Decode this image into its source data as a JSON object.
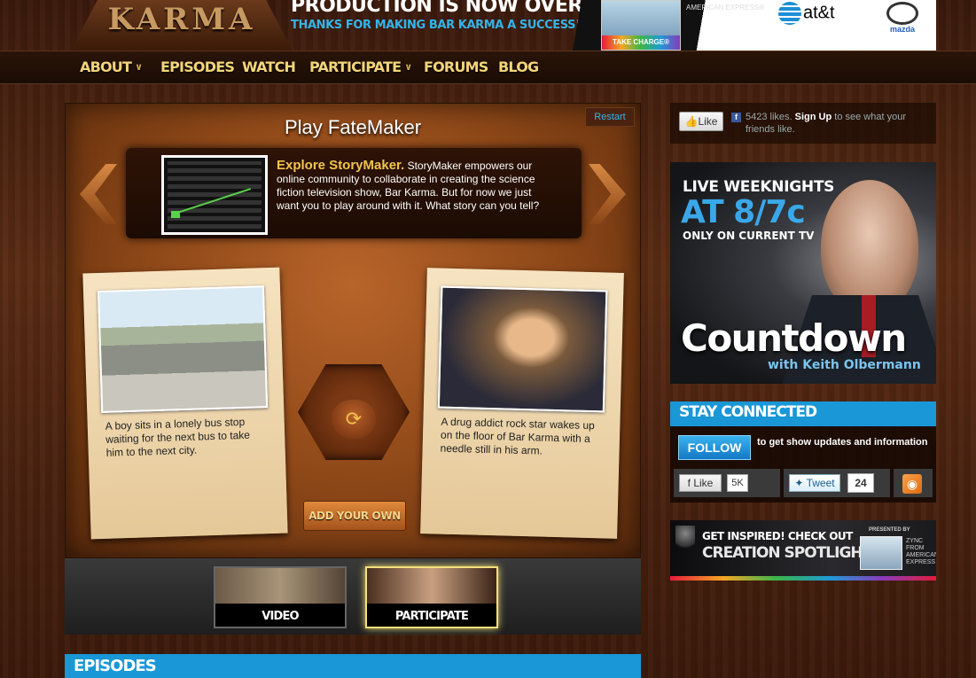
{
  "header": {
    "logo": "KARMA",
    "banner_title": "PRODUCTION IS NOW OVER",
    "banner_subtitle": "THANKS FOR MAKING BAR KARMA A SUCCESS!",
    "sponsors": {
      "amex_card_tagline": "TAKE CHARGE®",
      "amex_label": "AMERICAN EXPRESS®",
      "att": "at&t",
      "mazda": "mazda"
    }
  },
  "nav": {
    "items": [
      {
        "label": "ABOUT",
        "dropdown": true
      },
      {
        "label": "EPISODES",
        "dropdown": false
      },
      {
        "label": "WATCH",
        "dropdown": false
      },
      {
        "label": "PARTICIPATE",
        "dropdown": true
      },
      {
        "label": "FORUMS",
        "dropdown": false
      },
      {
        "label": "BLOG",
        "dropdown": false
      }
    ]
  },
  "fatemaker": {
    "title": "Play FateMaker",
    "restart": "Restart",
    "intro_heading": "Explore StoryMaker.",
    "intro_body": "StoryMaker empowers our online community to collaborate in creating the science fiction television show, Bar Karma. But for now we just want you to play around with it. What story can you tell?",
    "card_left_text": "A boy sits in a lonely bus stop waiting for the next bus to take him to the next city.",
    "card_right_text": "A drug addict rock star wakes up on the floor of Bar Karma with a needle still in his arm.",
    "spin_icon": "refresh-icon",
    "add_label": "ADD YOUR OWN"
  },
  "tray": {
    "video_label": "VIDEO",
    "participate_label": "PARTICIPATE"
  },
  "episodes_heading": "EPISODES",
  "sidebar": {
    "fb_like_label": "Like",
    "fb_likes_count": "5423 likes.",
    "fb_signup": "Sign Up",
    "fb_suffix": "to see what your friends like.",
    "ad": {
      "line1": "LIVE WEEKNIGHTS",
      "line2": "AT 8/7c",
      "line3": "ONLY ON CURRENT TV",
      "show": "Countdown",
      "with": "with Keith Olbermann"
    },
    "stay_connected": {
      "heading": "STAY CONNECTED",
      "follow_label": "FOLLOW",
      "follow_text": "to get show updates and information",
      "fb_like_label": "Like",
      "fb_count": "5K",
      "tweet_label": "Tweet",
      "tweet_count": "24",
      "rss_icon": "rss-icon"
    },
    "spotlight": {
      "line1": "GET INSPIRED! CHECK OUT",
      "line2": "CREATION SPOTLIGHT",
      "presented": "PRESENTED BY",
      "zync": "ZYNC FROM AMERICAN EXPRESS"
    }
  }
}
